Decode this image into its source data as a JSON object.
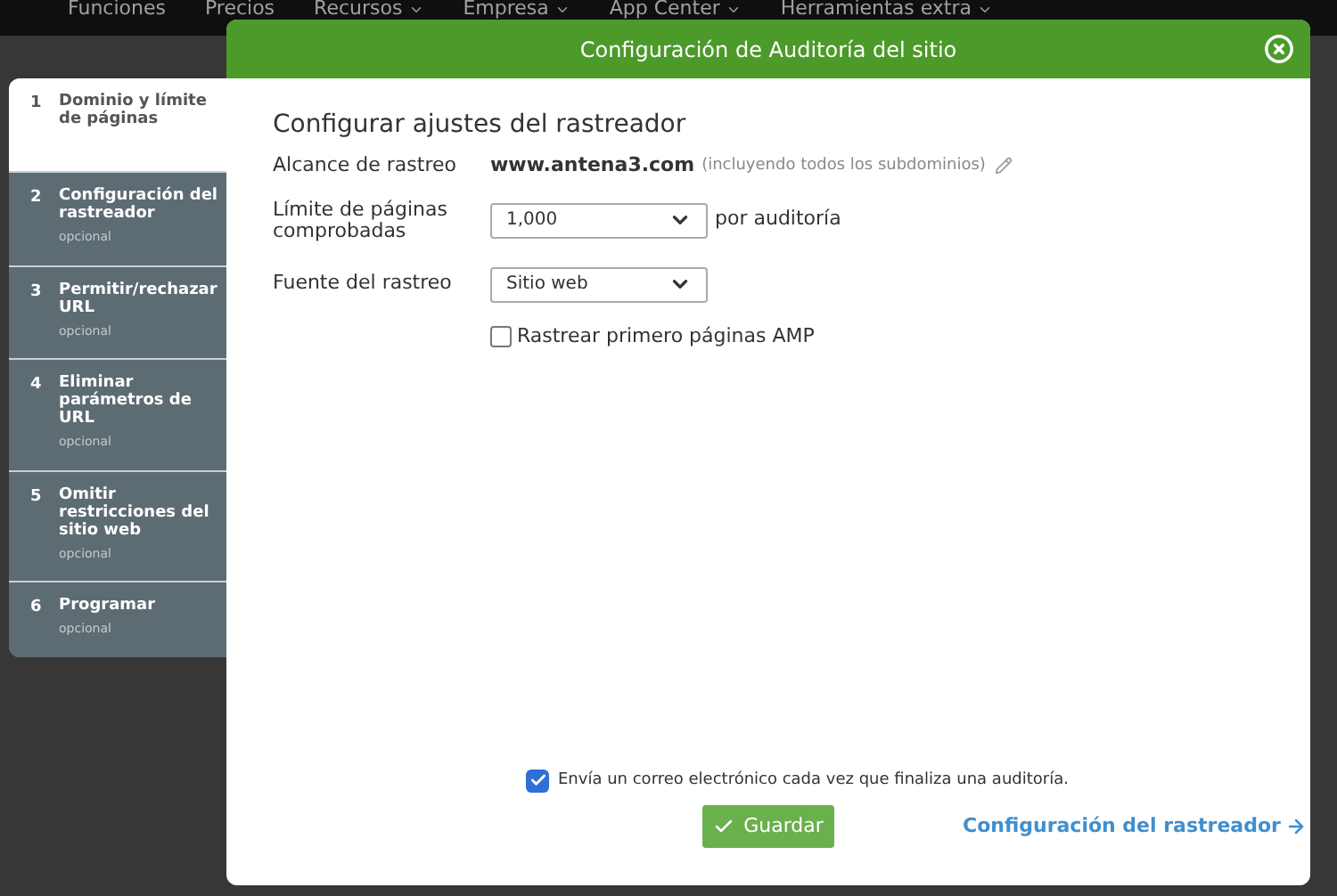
{
  "nav": {
    "items": [
      {
        "label": "Funciones",
        "dropdown": false
      },
      {
        "label": "Precios",
        "dropdown": false
      },
      {
        "label": "Recursos",
        "dropdown": true
      },
      {
        "label": "Empresa",
        "dropdown": true
      },
      {
        "label": "App Center",
        "dropdown": true
      },
      {
        "label": "Herramientas extra",
        "dropdown": true
      }
    ]
  },
  "dialog": {
    "title": "Configuración de Auditoría del sitio",
    "steps": [
      {
        "number": "1",
        "title": "Dominio y límite de páginas",
        "selected": true
      },
      {
        "number": "2",
        "title": "Configuración del rastreador",
        "subtitle": "opcional",
        "selected": false
      },
      {
        "number": "3",
        "title": "Permitir/rechazar URL",
        "subtitle": "opcional",
        "selected": false
      },
      {
        "number": "4",
        "title": "Eliminar parámetros de URL",
        "subtitle": "opcional",
        "selected": false
      },
      {
        "number": "5",
        "title": "Omitir restricciones del sitio web",
        "subtitle": "opcional",
        "selected": false
      },
      {
        "number": "6",
        "title": "Programar",
        "subtitle": "opcional",
        "selected": false
      }
    ],
    "heading": "Configurar ajustes del rastreador",
    "scope": {
      "label": "Alcance de rastreo",
      "domain": "www.antena3.com",
      "note": "(incluyendo todos los subdominios)"
    },
    "page_limit": {
      "label": "Límite de páginas comprobadas",
      "value": "1,000",
      "suffix": "por auditoría"
    },
    "source": {
      "label": "Fuente del rastreo",
      "value": "Sitio web"
    },
    "amp": {
      "label": "Rastrear primero páginas AMP",
      "checked": false
    },
    "email": {
      "label": "Envía un correo electrónico cada vez que finaliza una auditoría.",
      "checked": true
    },
    "save_button": "Guardar",
    "next_link": "Configuración del rastreador"
  }
}
